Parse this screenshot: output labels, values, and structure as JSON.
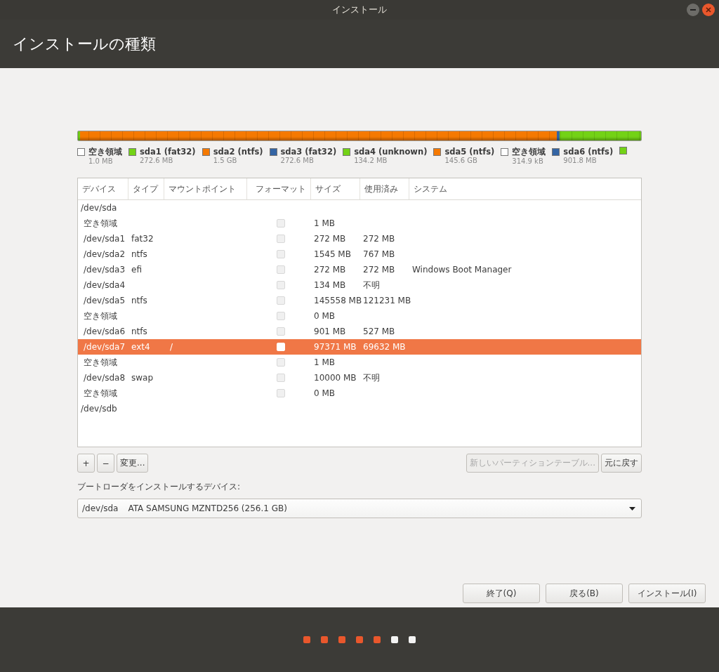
{
  "window": {
    "title": "インストール"
  },
  "header": {
    "title": "インストールの種類"
  },
  "legend": [
    {
      "name": "空き領域",
      "size": "1.0 MB",
      "color": "#ffffff"
    },
    {
      "name": "sda1 (fat32)",
      "size": "272.6 MB",
      "color": "#73d216"
    },
    {
      "name": "sda2 (ntfs)",
      "size": "1.5 GB",
      "color": "#f57900"
    },
    {
      "name": "sda3 (fat32)",
      "size": "272.6 MB",
      "color": "#3465a4"
    },
    {
      "name": "sda4 (unknown)",
      "size": "134.2 MB",
      "color": "#73d216"
    },
    {
      "name": "sda5 (ntfs)",
      "size": "145.6 GB",
      "color": "#f57900"
    },
    {
      "name": "空き領域",
      "size": "314.9 kB",
      "color": "#ffffff"
    },
    {
      "name": "sda6 (ntfs)",
      "size": "901.8 MB",
      "color": "#3465a4"
    },
    {
      "color": "#73d216"
    }
  ],
  "table": {
    "columns": [
      "デバイス",
      "タイプ",
      "マウントポイント",
      "フォーマット",
      "サイズ",
      "使用済み",
      "システム"
    ],
    "rows": [
      {
        "kind": "disk",
        "device": "/dev/sda",
        "selected": false
      },
      {
        "kind": "partition",
        "device": "空き領域",
        "type": "",
        "mount": "",
        "checked": false,
        "size": "1 MB",
        "used": "",
        "system": "",
        "selected": false
      },
      {
        "kind": "partition",
        "device": "/dev/sda1",
        "type": "fat32",
        "mount": "",
        "checked": false,
        "size": "272 MB",
        "used": "272 MB",
        "system": "",
        "selected": false
      },
      {
        "kind": "partition",
        "device": "/dev/sda2",
        "type": "ntfs",
        "mount": "",
        "checked": false,
        "size": "1545 MB",
        "used": "767 MB",
        "system": "",
        "selected": false
      },
      {
        "kind": "partition",
        "device": "/dev/sda3",
        "type": "efi",
        "mount": "",
        "checked": false,
        "size": "272 MB",
        "used": "272 MB",
        "system": "Windows Boot Manager",
        "selected": false
      },
      {
        "kind": "partition",
        "device": "/dev/sda4",
        "type": "",
        "mount": "",
        "checked": false,
        "size": "134 MB",
        "used": "不明",
        "system": "",
        "selected": false
      },
      {
        "kind": "partition",
        "device": "/dev/sda5",
        "type": "ntfs",
        "mount": "",
        "checked": false,
        "size": "145558 MB",
        "used": "121231 MB",
        "system": "",
        "selected": false
      },
      {
        "kind": "partition",
        "device": "空き領域",
        "type": "",
        "mount": "",
        "checked": false,
        "size": "0 MB",
        "used": "",
        "system": "",
        "selected": false
      },
      {
        "kind": "partition",
        "device": "/dev/sda6",
        "type": "ntfs",
        "mount": "",
        "checked": false,
        "size": "901 MB",
        "used": "527 MB",
        "system": "",
        "selected": false
      },
      {
        "kind": "partition",
        "device": "/dev/sda7",
        "type": "ext4",
        "mount": "/",
        "checked": false,
        "size": "97371 MB",
        "used": "69632 MB",
        "system": "",
        "selected": true
      },
      {
        "kind": "partition",
        "device": "空き領域",
        "type": "",
        "mount": "",
        "checked": false,
        "size": "1 MB",
        "used": "",
        "system": "",
        "selected": false
      },
      {
        "kind": "partition",
        "device": "/dev/sda8",
        "type": "swap",
        "mount": "",
        "checked": false,
        "size": "10000 MB",
        "used": "不明",
        "system": "",
        "selected": false
      },
      {
        "kind": "partition",
        "device": "空き領域",
        "type": "",
        "mount": "",
        "checked": false,
        "size": "0 MB",
        "used": "",
        "system": "",
        "selected": false
      },
      {
        "kind": "disk",
        "device": "/dev/sdb",
        "selected": false
      }
    ]
  },
  "table_buttons": {
    "add": "+",
    "remove": "−",
    "change": "変更...",
    "new_table": {
      "label": "新しいパーティションテーブル...",
      "disabled": true
    },
    "revert": {
      "label": "元に戻す",
      "disabled": false
    }
  },
  "bootloader": {
    "label": "ブートローダをインストールするデバイス:",
    "device": "/dev/sda",
    "description": "ATA SAMSUNG MZNTD256 (256.1 GB)"
  },
  "buttons": [
    "終了(Q)",
    "戻る(B)",
    "インストール(I)"
  ],
  "progress_dots": [
    {
      "done": true
    },
    {
      "done": true
    },
    {
      "done": true
    },
    {
      "done": true
    },
    {
      "done": true
    },
    {
      "done": false
    },
    {
      "done": false
    }
  ]
}
